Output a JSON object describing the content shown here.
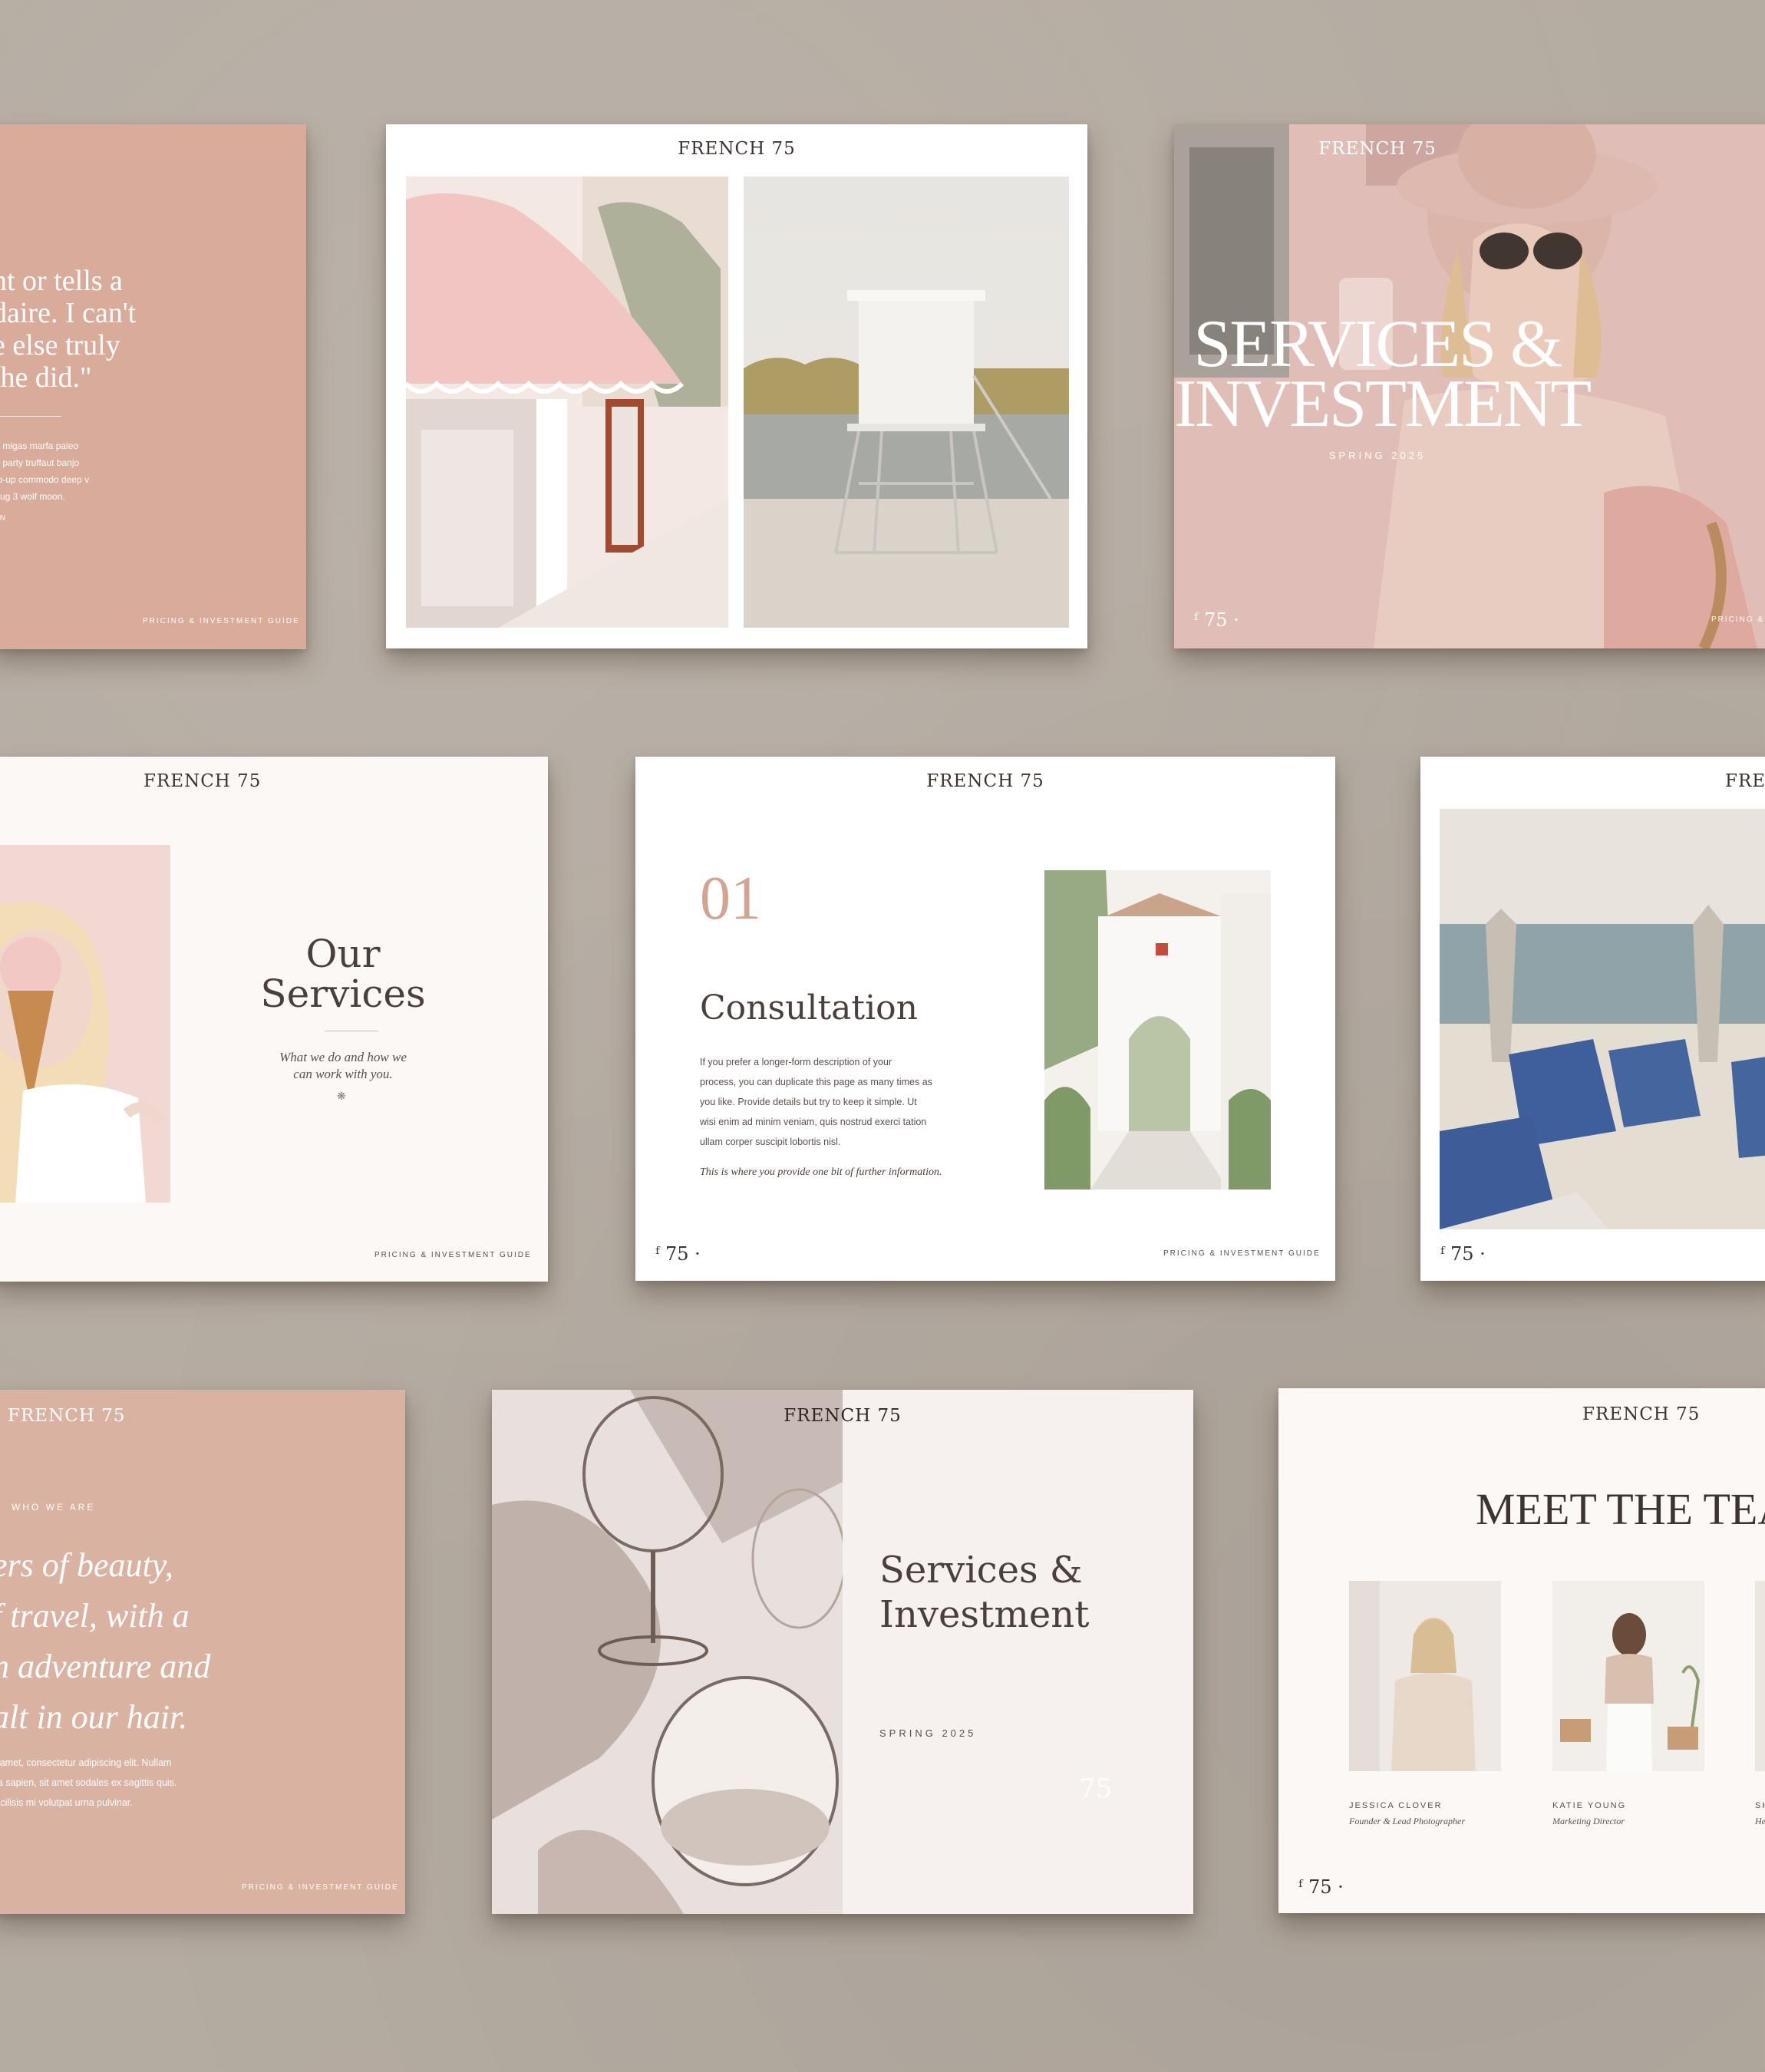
{
  "brand": "FRENCH 75",
  "footer_text": "PRICING & INVESTMENT GUIDE",
  "page_mark": "75",
  "card_quote": {
    "quote_lines": [
      "nt or tells a",
      "daire. I can't",
      "e else truly",
      "the did.\""
    ],
    "body_lines": [
      "a, migas marfa paleo",
      "of party truffaut banjo",
      "op-up commodo deep v",
      "mug 3 wolf moon."
    ],
    "signature": "ON"
  },
  "card_cover": {
    "title_line1": "SERVICES &",
    "title_line2": "INVESTMENT",
    "subtitle": "SPRING 2025",
    "footer_partial": "PRICING & I"
  },
  "card_services": {
    "title_line1": "Our",
    "title_line2": "Services",
    "caption_line1": "What we do and how we",
    "caption_line2": "can work with you."
  },
  "card_consultation": {
    "number": "01",
    "title": "Consultation",
    "body_lines": [
      "If you prefer a longer-form description of your",
      "process, you can duplicate this page as many times as",
      "you like. Provide details but try to keep it simple. Ut",
      "wisi enim ad minim veniam, quis nostrud exerci tation",
      "ullam corper suscipit lobortis nisl."
    ],
    "note": "This is where you provide one bit of further information."
  },
  "card_beach": {
    "logo_partial": "FREN"
  },
  "card_who": {
    "label": "WHO WE ARE",
    "script_lines": [
      "ers of beauty,",
      "f travel, with a",
      "n adventure and",
      "alt in our hair."
    ],
    "body_lines": [
      "it amet, consectetur adipiscing elit. Nullam",
      "da sapien, sit amet sodales ex sagittis quis.",
      "facilisis mi volutpat urna pulvinar."
    ]
  },
  "card_investment": {
    "title_line1": "Services &",
    "title_line2": "Investment",
    "subtitle": "SPRING 2025"
  },
  "card_team": {
    "title": "MEET THE TEAM",
    "members": [
      {
        "name": "JESSICA CLOVER",
        "role": "Founder & Lead Photographer"
      },
      {
        "name": "KATIE YOUNG",
        "role": "Marketing Director"
      },
      {
        "name": "SH",
        "role": "He"
      }
    ]
  },
  "colors": {
    "background": "#b4aba1",
    "blush": "#d8ab9b",
    "accent_number": "#d2a493",
    "ink": "#3d3330"
  }
}
